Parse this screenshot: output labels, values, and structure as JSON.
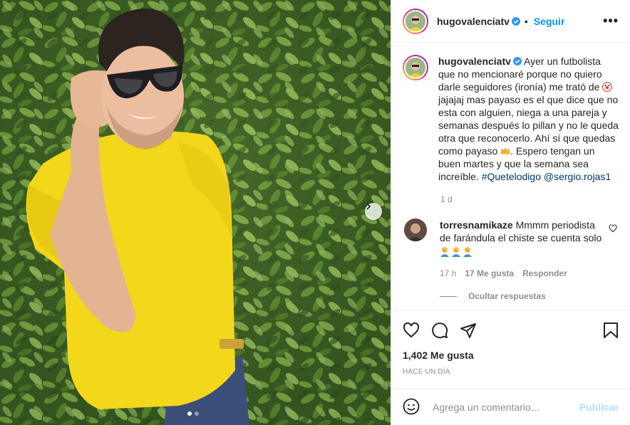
{
  "post": {
    "username": "hugovalenciatv",
    "follow_label": "Seguir",
    "more_label": "•••",
    "caption_lines": [
      "Ayer un futbolista que",
      "no mencionaré porque no quiero darle",
      "seguidores (ironía) me trató de",
      "jajajaj",
      "mas payaso es el que dice que no esta",
      "con alguien, niega a una pareja y",
      "semanas después lo pillan y no le queda",
      "otra que reconocerlo. Ahí sí que quedas",
      "como payaso",
      ". Espero tengan un",
      "buen martes y que la semana sea",
      "increíble."
    ],
    "hashtag": "#Quetelodigo",
    "mention": "@sergio.rojas1",
    "caption_time": "1 d",
    "emojis": [
      "clown-emoji",
      "crown-emoji"
    ]
  },
  "comment": {
    "username": "torresnamikaze",
    "text_line1": "Mmmm periodista",
    "text_line2": "de farándula el chiste se cuenta solo",
    "emoji_label": "facepalm-emoji x3",
    "time": "17 h",
    "likes": "17 Me gusta",
    "reply": "Responder",
    "hide_replies": "Ocultar respuestas"
  },
  "actions": {
    "likes_count": "1,402 Me gusta",
    "timestamp": "HACE UN DÍA"
  },
  "add_comment": {
    "placeholder": "Agrega un comentario...",
    "publish": "Publicar"
  },
  "carousel": {
    "total": 2,
    "active": 1
  },
  "colors": {
    "accent": "#0095f6",
    "shirt": "#f3d71b",
    "link": "#00376b"
  }
}
